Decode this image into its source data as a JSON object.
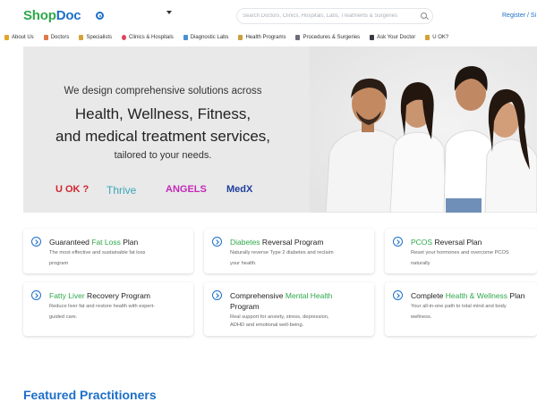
{
  "header": {
    "logo_shop": "Shop",
    "logo_doc": "Doc",
    "search_placeholder": "Search Doctors, Clinics, Hospitals, Labs, Treatments & Surgeries",
    "register": "Register / Si"
  },
  "nav": {
    "items": [
      {
        "label": "About Us",
        "icon": "info-icon"
      },
      {
        "label": "Doctors",
        "icon": "doctor-icon"
      },
      {
        "label": "Specialists",
        "icon": "specialist-icon"
      },
      {
        "label": "Clinics & Hospitals",
        "icon": "hospital-icon"
      },
      {
        "label": "Diagnostic Labs",
        "icon": "lab-icon"
      },
      {
        "label": "Health Programs",
        "icon": "program-icon"
      },
      {
        "label": "Procedures & Surgeries",
        "icon": "procedure-icon"
      },
      {
        "label": "Ask Your Doctor",
        "icon": "chat-icon"
      },
      {
        "label": "U OK?",
        "icon": "heart-icon"
      }
    ]
  },
  "hero": {
    "sub": "We design comprehensive solutions across",
    "title_line1": "Health, Wellness, Fitness,",
    "title_line2": "and medical treatment services,",
    "tail": "tailored to your needs.",
    "brands": [
      "U OK ?",
      "Thrive",
      "ANGELS",
      "MedX"
    ]
  },
  "programs": [
    {
      "pre": "Guaranteed ",
      "hl": "Fat Loss",
      "post": " Plan",
      "desc1": "The most effective and sustainable fat loss",
      "desc2": "program"
    },
    {
      "pre": "",
      "hl": "Diabetes",
      "post": " Reversal Program",
      "desc1": "Naturally reverse Type 2 diabetes and reclaim",
      "desc2": "your health."
    },
    {
      "pre": "",
      "hl": "PCOS",
      "post": " Reversal Plan",
      "desc1": "Reset your hormones and overcome PCOS",
      "desc2": "naturally"
    },
    {
      "pre": "",
      "hl": "Fatty Liver",
      "post": " Recovery Program",
      "desc1": "Reduce liver fat and restore health with expert-",
      "desc2": "guided care."
    },
    {
      "pre": "Comprehensive ",
      "hl": "Mental Health",
      "post": "",
      "post2": "Program",
      "desc1": "Real support for anxiety, stress, depression,",
      "desc2": "ADHD and emotional well-being."
    },
    {
      "pre": "Complete ",
      "hl": "Health & Wellness",
      "post": " Plan",
      "desc1": "Your all-in-one path to total mind and body",
      "desc2": "wellness."
    }
  ],
  "featured_title": "Featured Practitioners",
  "colors": {
    "brand_green": "#2ea84a",
    "brand_blue": "#1d6fc9",
    "hero_bg": "#e9e9e9"
  }
}
